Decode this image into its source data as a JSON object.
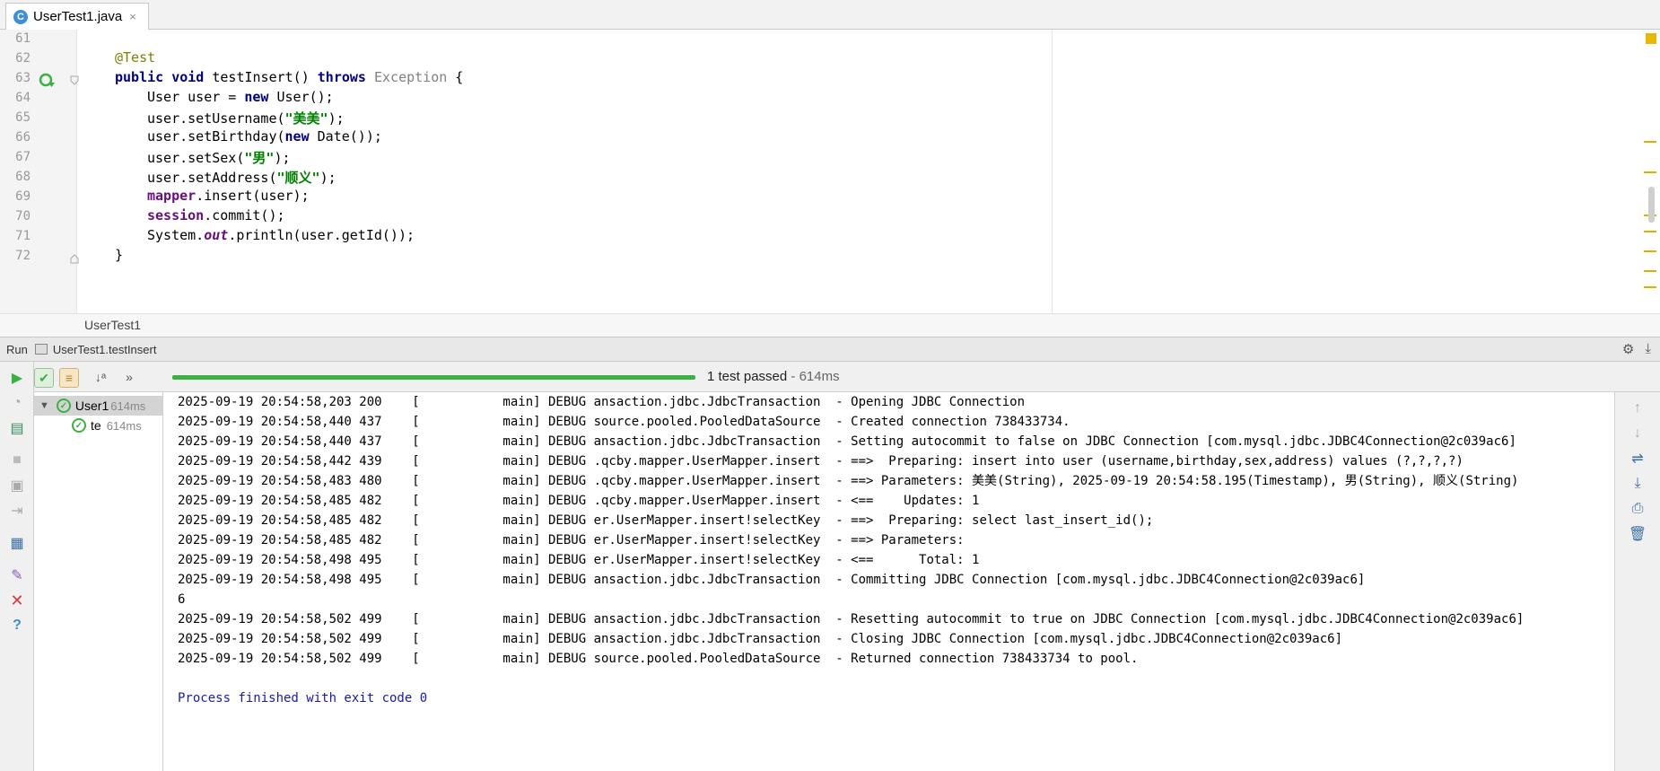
{
  "tab": {
    "label": "UserTest1.java",
    "icon": "class-file-icon",
    "close": "×"
  },
  "editor": {
    "lines": [
      {
        "num": "61"
      },
      {
        "num": "62"
      },
      {
        "num": "63"
      },
      {
        "num": "64"
      },
      {
        "num": "65"
      },
      {
        "num": "66"
      },
      {
        "num": "67"
      },
      {
        "num": "68"
      },
      {
        "num": "69"
      },
      {
        "num": "70"
      },
      {
        "num": "71"
      },
      {
        "num": "72"
      }
    ],
    "code": {
      "l62": "@Test",
      "l63_kw1": "public void",
      "l63_name": " testInsert() ",
      "l63_kw2": "throws",
      "l63_exc": " Exception",
      "l63_end": " {",
      "l64_a": "User user = ",
      "l64_kw": "new",
      "l64_b": " User();",
      "l65_a": "user.setUsername(",
      "l65_s": "\"美美\"",
      "l65_b": ");",
      "l66_a": "user.setBirthday(",
      "l66_kw": "new",
      "l66_b": " Date());",
      "l67_a": "user.setSex(",
      "l67_s": "\"男\"",
      "l67_b": ");",
      "l68_a": "user.setAddress(",
      "l68_s": "\"顺义\"",
      "l68_b": ");",
      "l69_f": "mapper",
      "l69_b": ".insert(user);",
      "l70_f": "session",
      "l70_b": ".commit();",
      "l71_a": "System.",
      "l71_f": "out",
      "l71_b": ".println(user.getId());",
      "l72": "}"
    },
    "breadcrumb": "UserTest1"
  },
  "run": {
    "label": "Run",
    "config": "UserTest1.testInsert",
    "status": "1 test passed",
    "duration": " - 614ms"
  },
  "tree": {
    "root": {
      "label": "User1",
      "time": "614ms"
    },
    "child": {
      "label": "te",
      "time": "614ms"
    }
  },
  "console": {
    "lines": [
      "2025-09-19 20:54:58,203 200    [           main] DEBUG ansaction.jdbc.JdbcTransaction  - Opening JDBC Connection",
      "2025-09-19 20:54:58,440 437    [           main] DEBUG source.pooled.PooledDataSource  - Created connection 738433734.",
      "2025-09-19 20:54:58,440 437    [           main] DEBUG ansaction.jdbc.JdbcTransaction  - Setting autocommit to false on JDBC Connection [com.mysql.jdbc.JDBC4Connection@2c039ac6]",
      "2025-09-19 20:54:58,442 439    [           main] DEBUG .qcby.mapper.UserMapper.insert  - ==>  Preparing: insert into user (username,birthday,sex,address) values (?,?,?,?)",
      "2025-09-19 20:54:58,483 480    [           main] DEBUG .qcby.mapper.UserMapper.insert  - ==> Parameters: 美美(String), 2025-09-19 20:54:58.195(Timestamp), 男(String), 顺义(String)",
      "2025-09-19 20:54:58,485 482    [           main] DEBUG .qcby.mapper.UserMapper.insert  - <==    Updates: 1",
      "2025-09-19 20:54:58,485 482    [           main] DEBUG er.UserMapper.insert!selectKey  - ==>  Preparing: select last_insert_id();",
      "2025-09-19 20:54:58,485 482    [           main] DEBUG er.UserMapper.insert!selectKey  - ==> Parameters: ",
      "2025-09-19 20:54:58,498 495    [           main] DEBUG er.UserMapper.insert!selectKey  - <==      Total: 1",
      "2025-09-19 20:54:58,498 495    [           main] DEBUG ansaction.jdbc.JdbcTransaction  - Committing JDBC Connection [com.mysql.jdbc.JDBC4Connection@2c039ac6]",
      "6",
      "2025-09-19 20:54:58,502 499    [           main] DEBUG ansaction.jdbc.JdbcTransaction  - Resetting autocommit to true on JDBC Connection [com.mysql.jdbc.JDBC4Connection@2c039ac6]",
      "2025-09-19 20:54:58,502 499    [           main] DEBUG ansaction.jdbc.JdbcTransaction  - Closing JDBC Connection [com.mysql.jdbc.JDBC4Connection@2c039ac6]",
      "2025-09-19 20:54:58,502 499    [           main] DEBUG source.pooled.PooledDataSource  - Returned connection 738433734 to pool.",
      "",
      "Process finished with exit code 0"
    ]
  },
  "colors": {
    "pass_green": "#3cb043",
    "keyword": "#000080",
    "string": "#008000",
    "annotation": "#808000",
    "field": "#660e7a"
  }
}
